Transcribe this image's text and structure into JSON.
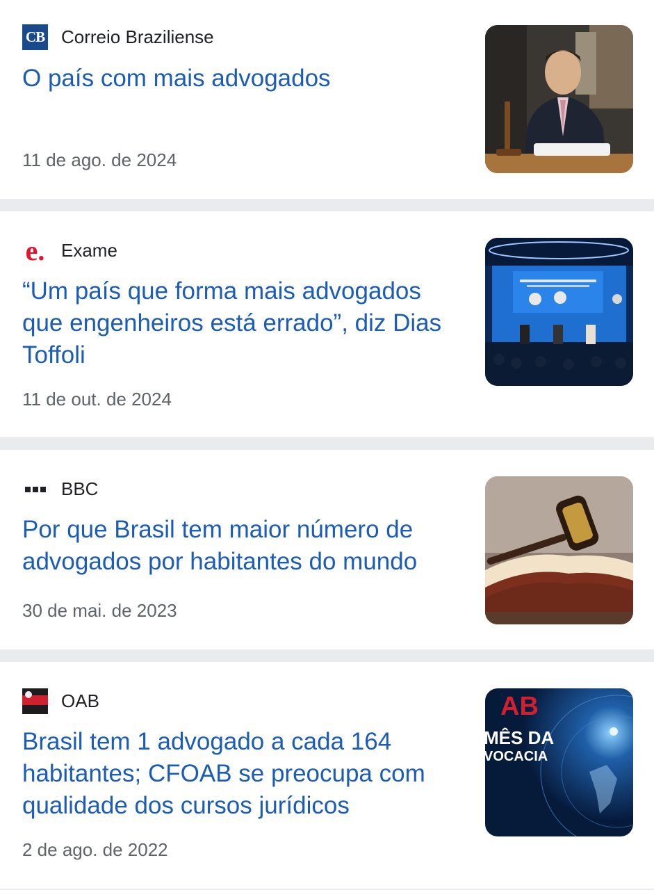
{
  "articles": [
    {
      "source": "Correio Braziliense",
      "logo_icon": "correio-braziliense-logo-icon",
      "logo_text": "CB",
      "headline": "O país com mais advogados",
      "date": "11 de ago. de 2024",
      "thumbnail": "man-in-suit-at-desk-with-gavel-image"
    },
    {
      "source": "Exame",
      "logo_icon": "exame-logo-icon",
      "logo_text": "e.",
      "headline": "“Um país que forma mais advogados que engenheiros está errado”, diz Dias Toffoli",
      "date": "11 de out. de 2024",
      "thumbnail": "conference-stage-panel-image"
    },
    {
      "source": "BBC",
      "logo_icon": "bbc-logo-icon",
      "headline": "Por que Brasil tem maior número de advogados por habitantes do mundo",
      "date": "30 de mai. de 2023",
      "thumbnail": "gavel-on-book-image"
    },
    {
      "source": "OAB",
      "logo_icon": "oab-logo-icon",
      "headline": "Brasil tem 1 advogado a cada 164 habitantes; CFOAB se preocupa com qualidade dos cursos jurídicos",
      "date": "2 de ago. de 2022",
      "thumbnail": "mes-da-advocacia-globe-image",
      "thumbnail_text": {
        "line1": "MÊS DA",
        "line2": "VOCACIA",
        "logo": "AB"
      }
    }
  ],
  "colors": {
    "headline": "#1a5cb8",
    "date": "#5f6368",
    "source": "#202124",
    "separator": "#e9ebee"
  }
}
